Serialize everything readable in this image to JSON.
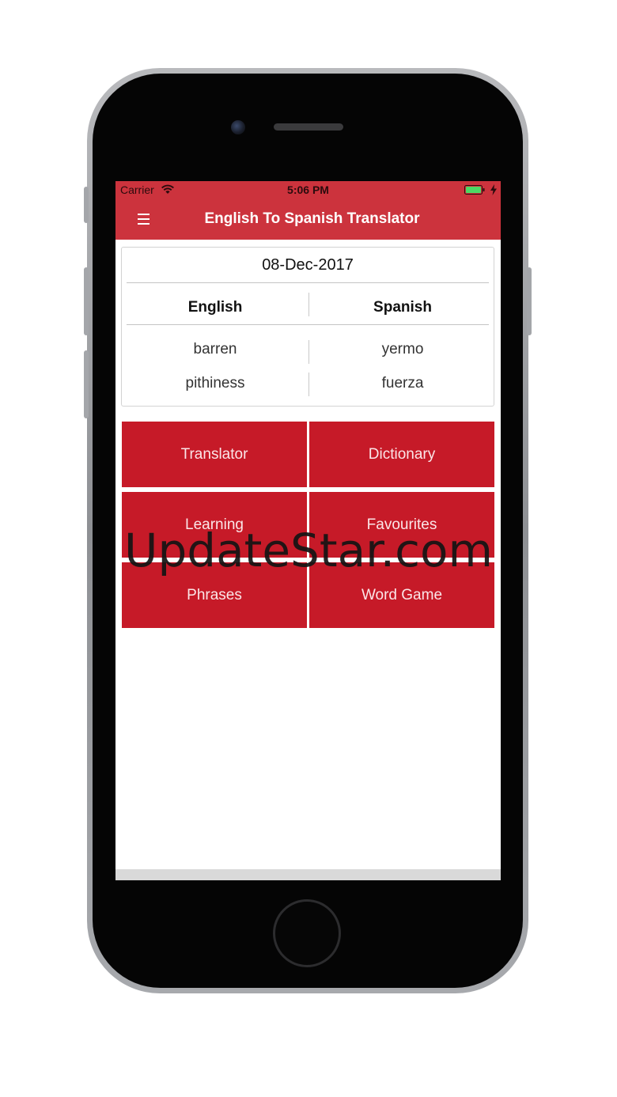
{
  "status_bar": {
    "carrier": "Carrier",
    "time": "5:06 PM",
    "icons": [
      "wifi-icon",
      "battery-icon",
      "charging-bolt-icon"
    ],
    "battery_color": "#4cd964"
  },
  "nav_bar": {
    "menu_icon": "hamburger-menu-icon",
    "title": "English To Spanish Translator",
    "background": "#cc333d"
  },
  "word_of_day": {
    "date": "08-Dec-2017",
    "headers": {
      "left": "English",
      "right": "Spanish"
    },
    "rows": [
      {
        "english": "barren",
        "spanish": "yermo"
      },
      {
        "english": "pithiness",
        "spanish": "fuerza"
      }
    ]
  },
  "menu": {
    "tile_color": "#c61a28",
    "tiles": [
      {
        "label": "Translator"
      },
      {
        "label": "Dictionary"
      },
      {
        "label": "Learning"
      },
      {
        "label": "Favourites"
      },
      {
        "label": "Phrases"
      },
      {
        "label": "Word Game"
      }
    ]
  },
  "watermark": "UpdateStar.com"
}
